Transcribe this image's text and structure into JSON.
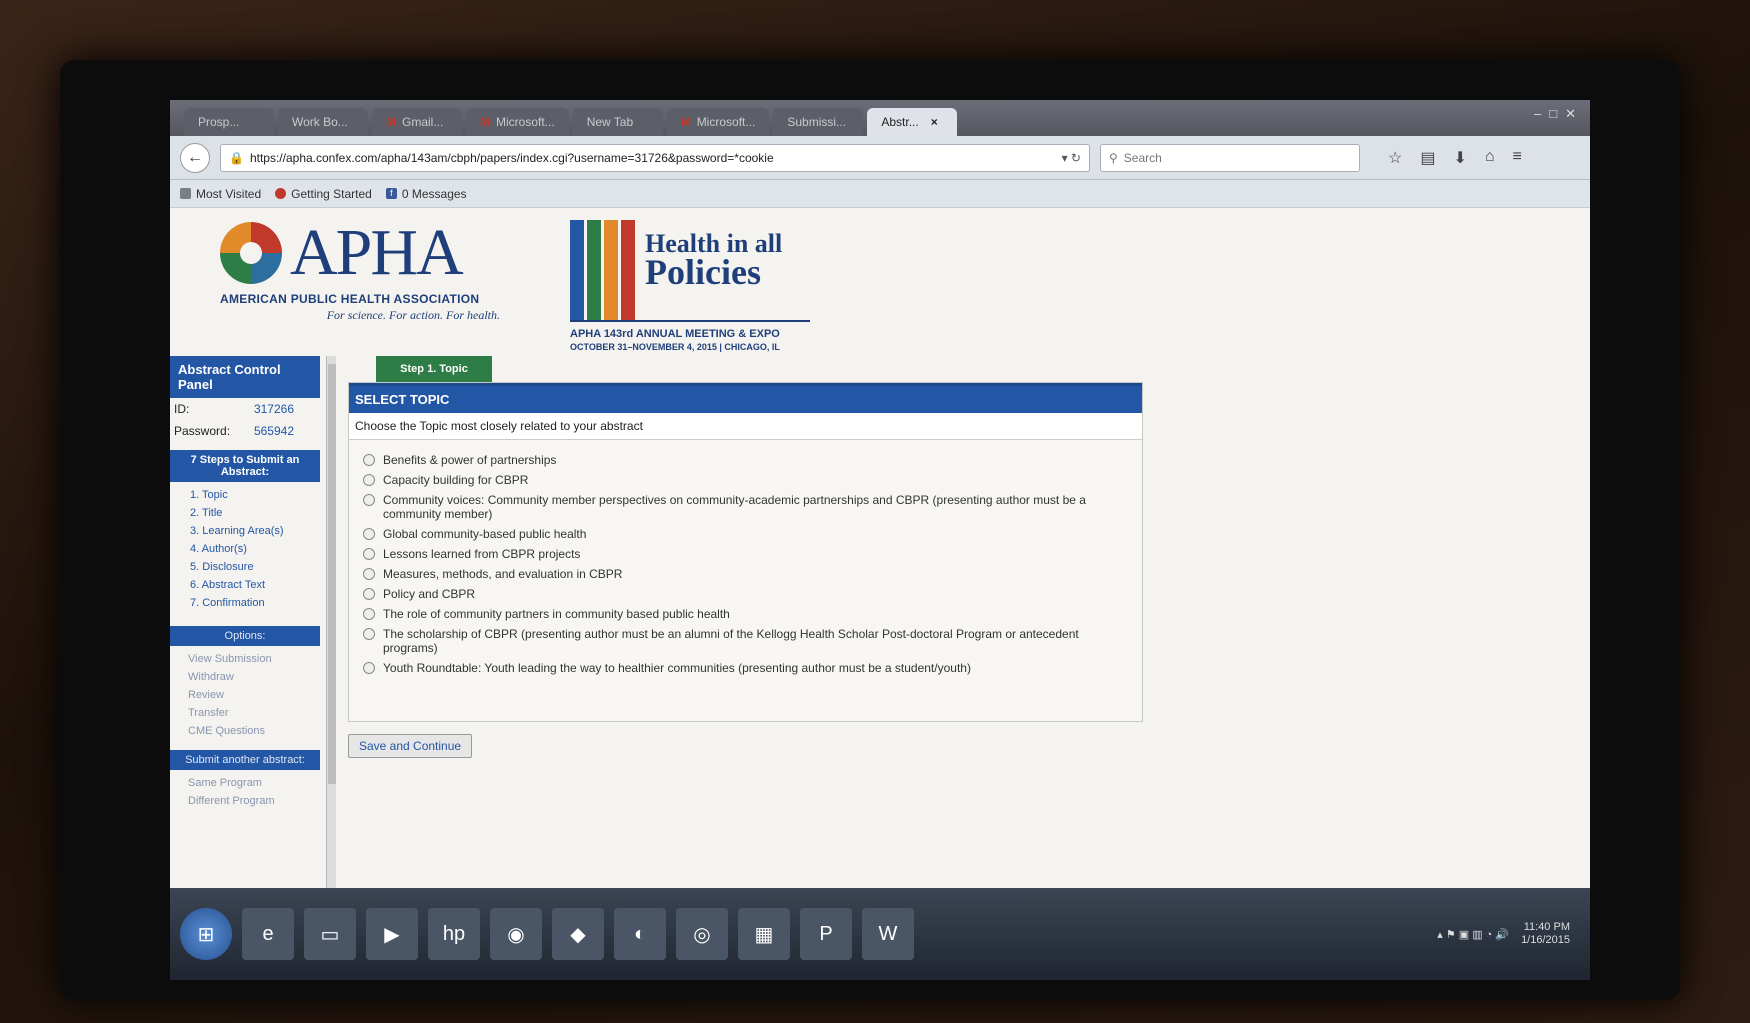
{
  "browser": {
    "tabs": [
      {
        "label": "Prosp...",
        "mark": "",
        "active": false
      },
      {
        "label": "Work Bo...",
        "mark": "",
        "active": false
      },
      {
        "label": "Gmail...",
        "mark": "M",
        "active": false
      },
      {
        "label": "Microsoft...",
        "mark": "M",
        "active": false
      },
      {
        "label": "New Tab",
        "mark": "",
        "active": false
      },
      {
        "label": "Microsoft...",
        "mark": "M",
        "active": false
      },
      {
        "label": "Submissi...",
        "mark": "",
        "active": false
      },
      {
        "label": "Abstr...",
        "mark": "",
        "active": true
      }
    ],
    "tab_close": "×",
    "url": "https://apha.confex.com/apha/143am/cbph/papers/index.cgi?username=31726&password=*cookie",
    "search_placeholder": "Search",
    "bookmarks": [
      "Most Visited",
      "Getting Started",
      "0 Messages"
    ]
  },
  "header": {
    "apha_word": "APHA",
    "apha_full": "AMERICAN PUBLIC HEALTH ASSOCIATION",
    "apha_tag": "For science. For action. For health.",
    "hiap_line1": "Health in all",
    "hiap_line2": "Policies",
    "meeting": "APHA 143rd ANNUAL MEETING & EXPO",
    "dates": "OCTOBER 31–NOVEMBER 4, 2015 | CHICAGO, IL",
    "pillar_colors": [
      "#2456a6",
      "#2f7d46",
      "#e08a2a",
      "#c0392b"
    ]
  },
  "sidebar": {
    "title": "Abstract Control Panel",
    "id_label": "ID:",
    "id_value": "317266",
    "password_label": "Password:",
    "password_value": "565942",
    "steps_title": "7 Steps to Submit an Abstract:",
    "steps": [
      "1. Topic",
      "2. Title",
      "3. Learning Area(s)",
      "4. Author(s)",
      "5. Disclosure",
      "6. Abstract Text",
      "7. Confirmation"
    ],
    "options_title": "Options:",
    "options": [
      "View Submission",
      "Withdraw",
      "Review",
      "Transfer",
      "CME Questions"
    ],
    "submit_another_title": "Submit another abstract:",
    "submit_another": [
      "Same Program",
      "Different Program"
    ]
  },
  "form": {
    "step_tab": "Step 1. Topic",
    "heading": "SELECT TOPIC",
    "instruction": "Choose the Topic most closely related to your abstract",
    "topics": [
      "Benefits & power of partnerships",
      "Capacity building for CBPR",
      "Community voices: Community member perspectives on community-academic partnerships and CBPR (presenting author must be a community member)",
      "Global community-based public health",
      "Lessons learned from CBPR projects",
      "Measures, methods, and evaluation in CBPR",
      "Policy and CBPR",
      "The role of community partners in community based public health",
      "The scholarship of CBPR (presenting author must be an alumni of the Kellogg Health Scholar Post-doctoral Program or antecedent programs)",
      "Youth Roundtable: Youth leading the way to healthier communities (presenting author must be a student/youth)"
    ],
    "save_button": "Save and Continue"
  },
  "taskbar": {
    "apps": [
      "start-icon",
      "ie-icon",
      "folder-icon",
      "media-icon",
      "hp-icon",
      "chrome-icon",
      "app-icon",
      "firefox-icon",
      "app2-icon",
      "files-icon",
      "powerpoint-icon",
      "word-icon"
    ],
    "time": "11:40 PM",
    "date": "1/16/2015"
  }
}
